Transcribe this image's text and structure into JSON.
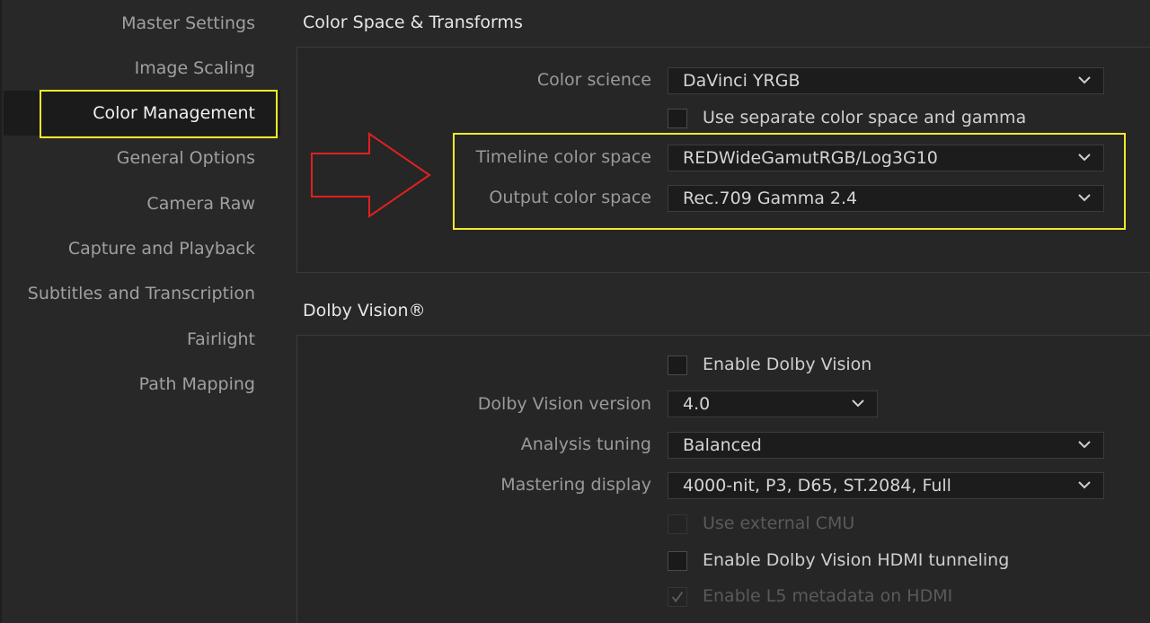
{
  "sidebar": {
    "items": [
      {
        "label": "Master Settings"
      },
      {
        "label": "Image Scaling"
      },
      {
        "label": "Color Management"
      },
      {
        "label": "General Options"
      },
      {
        "label": "Camera Raw"
      },
      {
        "label": "Capture and Playback"
      },
      {
        "label": "Subtitles and Transcription"
      },
      {
        "label": "Fairlight"
      },
      {
        "label": "Path Mapping"
      }
    ],
    "active": "Color Management"
  },
  "color_space": {
    "title": "Color Space & Transforms",
    "color_science_label": "Color science",
    "color_science_value": "DaVinci YRGB",
    "separate_label": "Use separate color space and gamma",
    "separate_checked": false,
    "timeline_label": "Timeline color space",
    "timeline_value": "REDWideGamutRGB/Log3G10",
    "output_label": "Output color space",
    "output_value": "Rec.709 Gamma 2.4"
  },
  "dolby": {
    "title": "Dolby Vision®",
    "enable_label": "Enable Dolby Vision",
    "version_label": "Dolby Vision version",
    "version_value": "4.0",
    "tuning_label": "Analysis tuning",
    "tuning_value": "Balanced",
    "mastering_label": "Mastering display",
    "mastering_value": "4000-nit, P3, D65, ST.2084, Full",
    "cmu_label": "Use external CMU",
    "hdmi_label": "Enable Dolby Vision HDMI tunneling",
    "l5_label": "Enable L5 metadata on HDMI",
    "l5_checked": true
  },
  "colors": {
    "highlight": "#f0ea2a",
    "arrow": "#e02020",
    "background": "#282828"
  }
}
